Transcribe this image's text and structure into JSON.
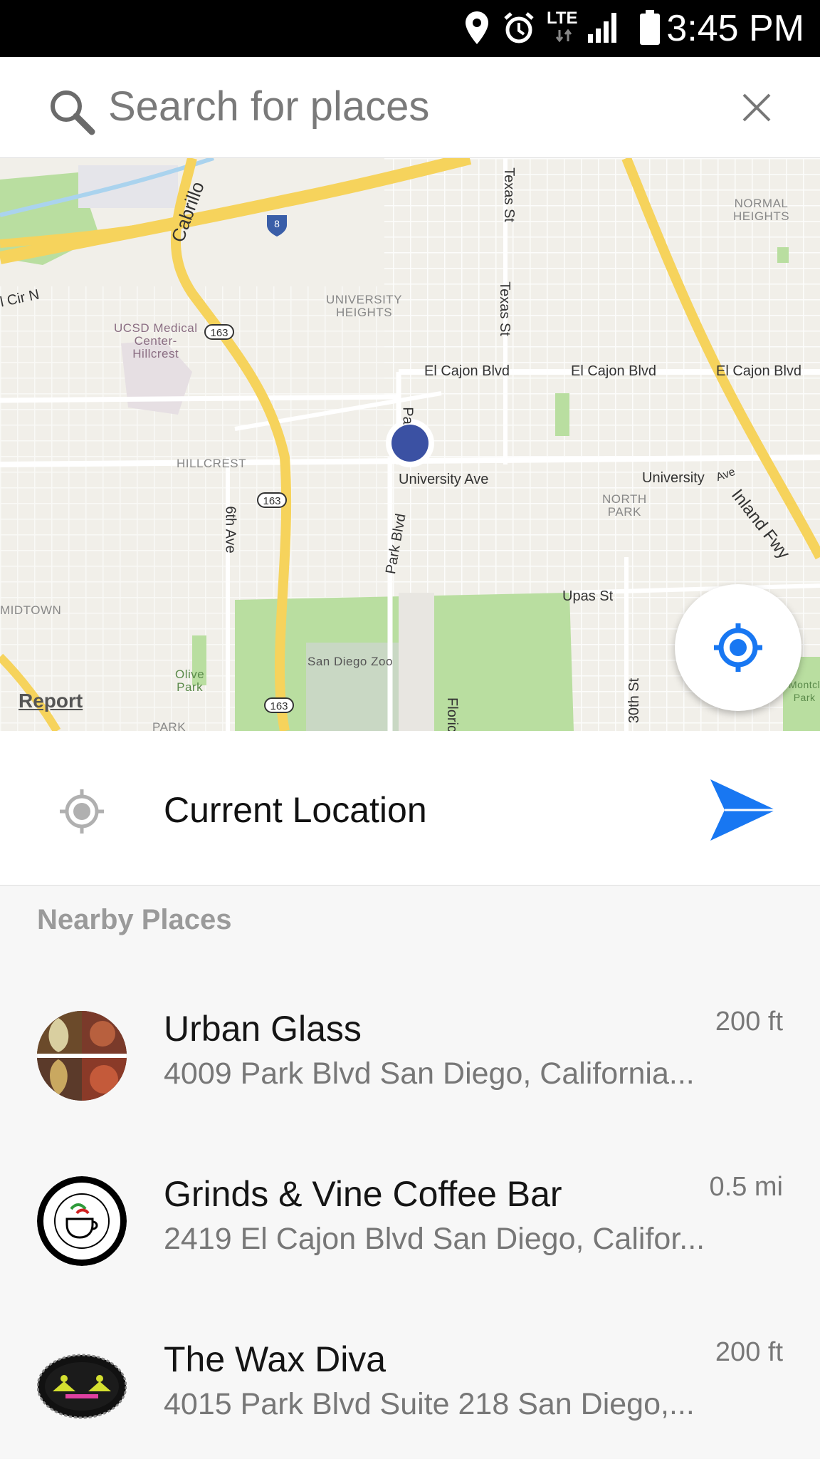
{
  "status_bar": {
    "time": "3:45 PM",
    "network": "LTE"
  },
  "search": {
    "placeholder": "Search for places"
  },
  "map": {
    "roads": {
      "el_cajon_1": "El Cajon Blvd",
      "el_cajon_2": "El Cajon Blvd",
      "el_cajon_3": "El Cajon Blvd",
      "university_1": "University Ave",
      "university_2": "University",
      "university_2b": "Ave",
      "texas_1": "Texas St",
      "texas_2": "Texas St",
      "park_blvd": "Park Blvd",
      "pa": "Pa",
      "sixth_ave": "6th Ave",
      "upas": "Upas St",
      "thirtieth": "30th St",
      "inland_fwy": "Inland Fwy",
      "cabrillo": "Cabrillo",
      "cir_n": "l Cir N",
      "florida": "Floric"
    },
    "areas": {
      "normal_heights": "NORMAL\nHEIGHTS",
      "university_heights": "UNIVERSITY\nHEIGHTS",
      "hillcrest": "HILLCREST",
      "north_park": "NORTH\nPARK",
      "midtown": "MIDTOWN",
      "ucsd": "UCSD Medical\nCenter-\nHillcrest",
      "zoo": "San Diego Zoo",
      "olive_park": "Olive\nPark",
      "park": "PARK",
      "montclair": "Montcl\nPark"
    },
    "shields": {
      "i8": "8",
      "sr163_a": "163",
      "sr163_b": "163",
      "sr163_c": "163"
    },
    "report_label": "Report",
    "colors": {
      "user_dot": "#3b51a3",
      "highway": "#f6d35c",
      "park": "#b9dea0"
    }
  },
  "current_location": {
    "label": "Current Location",
    "accent": "#1877f2"
  },
  "nearby": {
    "title": "Nearby Places",
    "places": [
      {
        "name": "Urban Glass",
        "address": "4009 Park Blvd San Diego, California...",
        "distance": "200 ft"
      },
      {
        "name": "Grinds & Vine Coffee Bar",
        "address": "2419 El Cajon Blvd San Diego, Califor...",
        "distance": "0.5 mi"
      },
      {
        "name": "The Wax Diva",
        "address": "4015 Park Blvd Suite 218 San Diego,...",
        "distance": "200 ft"
      }
    ]
  }
}
